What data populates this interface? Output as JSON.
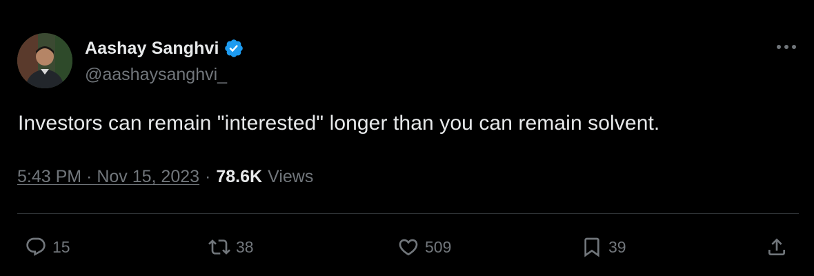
{
  "tweet": {
    "author": {
      "display_name": "Aashay Sanghvi",
      "handle": "@aashaysanghvi_",
      "verified_icon": "verified-badge-icon"
    },
    "text": "Investors can remain \"interested\" longer than you can remain solvent.",
    "timestamp": "5:43 PM · Nov 15, 2023",
    "separator": "·",
    "views_count": "78.6K",
    "views_label": "Views"
  },
  "actions": {
    "reply": {
      "icon": "reply-icon",
      "count": "15"
    },
    "retweet": {
      "icon": "retweet-icon",
      "count": "38"
    },
    "like": {
      "icon": "heart-icon",
      "count": "509"
    },
    "bookmark": {
      "icon": "bookmark-icon",
      "count": "39"
    },
    "share": {
      "icon": "share-icon"
    }
  },
  "colors": {
    "background": "#000000",
    "text_primary": "#e7e9ea",
    "text_secondary": "#71767b",
    "divider": "#2f3336",
    "verified": "#1d9bf0"
  }
}
